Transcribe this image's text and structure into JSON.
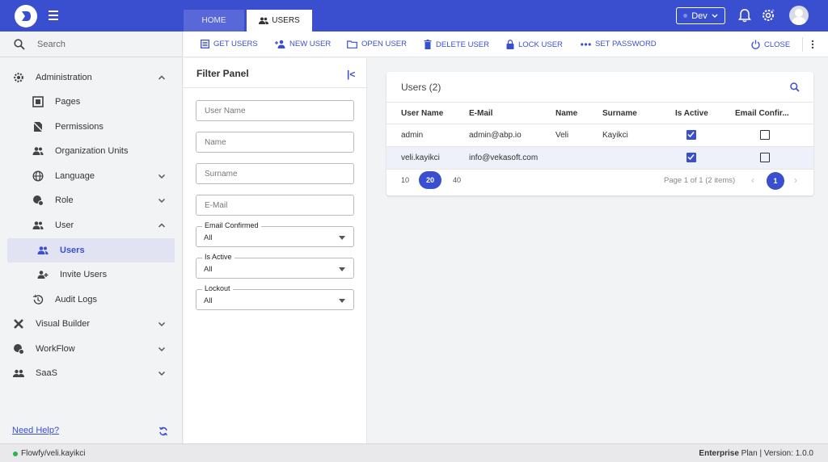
{
  "header": {
    "tabs": [
      {
        "label": "HOME"
      },
      {
        "label": "USERS"
      }
    ],
    "env": "Dev"
  },
  "sidebar": {
    "search_placeholder": "Search",
    "items": [
      {
        "label": "Administration",
        "icon": "gear-icon",
        "expanded": true
      },
      {
        "label": "Pages",
        "icon": "pages-icon"
      },
      {
        "label": "Permissions",
        "icon": "permissions-icon"
      },
      {
        "label": "Organization Units",
        "icon": "org-units-icon"
      },
      {
        "label": "Language",
        "icon": "globe-icon"
      },
      {
        "label": "Role",
        "icon": "role-icon"
      },
      {
        "label": "User",
        "icon": "user-group-icon",
        "expanded": true
      },
      {
        "label": "Users",
        "icon": "users-icon",
        "active": true
      },
      {
        "label": "Invite Users",
        "icon": "invite-user-icon"
      },
      {
        "label": "Audit Logs",
        "icon": "history-icon"
      },
      {
        "label": "Visual Builder",
        "icon": "tools-icon"
      },
      {
        "label": "WorkFlow",
        "icon": "workflow-icon"
      },
      {
        "label": "SaaS",
        "icon": "saas-icon"
      }
    ],
    "help": "Need Help?"
  },
  "toolbar": {
    "get_users": "GET USERS",
    "new_user": "NEW USER",
    "open_user": "OPEN USER",
    "delete_user": "DELETE USER",
    "lock_user": "LOCK USER",
    "set_password": "SET PASSWORD",
    "close": "CLOSE"
  },
  "filter": {
    "title": "Filter Panel",
    "user_name": "User Name",
    "name": "Name",
    "surname": "Surname",
    "email": "E-Mail",
    "email_confirmed": {
      "label": "Email Confirmed",
      "value": "All"
    },
    "is_active": {
      "label": "Is Active",
      "value": "All"
    },
    "lockout": {
      "label": "Lockout",
      "value": "All"
    }
  },
  "table": {
    "title": "Users (2)",
    "columns": [
      "User Name",
      "E-Mail",
      "Name",
      "Surname",
      "Is Active",
      "Email Confir..."
    ],
    "rows": [
      {
        "user_name": "admin",
        "email": "admin@abp.io",
        "name": "Veli",
        "surname": "Kayikci",
        "is_active": true,
        "email_confirmed": false
      },
      {
        "user_name": "veli.kayikci",
        "email": "info@vekasoft.com",
        "name": "",
        "surname": "",
        "is_active": true,
        "email_confirmed": false
      }
    ],
    "page_sizes": [
      "10",
      "20",
      "40"
    ],
    "page_size_selected": "20",
    "page_info": "Page 1 of 1 (2 items)",
    "current_page": "1"
  },
  "footer": {
    "user": "Flowfy/veli.kayikci",
    "plan_bold": "Enterprise",
    "plan_rest": " Plan | Version: 1.0.0"
  },
  "colors": {
    "primary": "#3a4fd0",
    "active_bg": "#e1e3f3",
    "status_dot": "#2db34a"
  }
}
